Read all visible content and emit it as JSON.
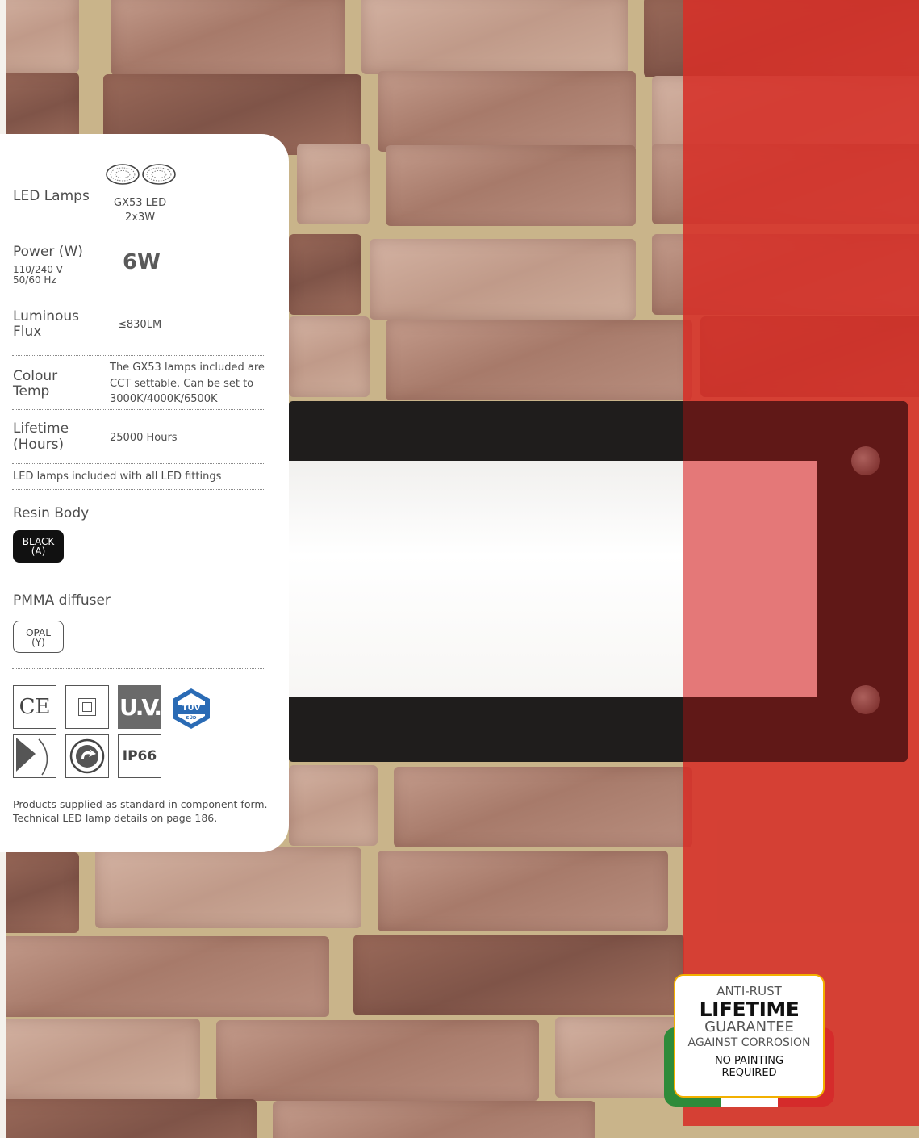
{
  "specs": {
    "led_lamps_label": "LED Lamps",
    "led_lamps_value_1": "GX53 LED",
    "led_lamps_value_2": "2x3W",
    "power_label": "Power (W)",
    "power_voltage": "110/240 V",
    "power_frequency": "50/60 Hz",
    "power_value": "6W",
    "flux_label_1": "Luminous",
    "flux_label_2": "Flux",
    "flux_value": "≤830LM",
    "colour_label_1": "Colour",
    "colour_label_2": "Temp",
    "colour_value_1": "The GX53 lamps included are",
    "colour_value_2": "CCT settable.  Can be set to",
    "colour_value_3": "3000K/4000K/6500K",
    "lifetime_label_1": "Lifetime",
    "lifetime_label_2": "(Hours)",
    "lifetime_value": "25000 Hours",
    "included_note": "LED lamps included with all LED fittings"
  },
  "body": {
    "heading": "Resin Body",
    "finish_1": "BLACK",
    "finish_2": "(A)"
  },
  "diffuser": {
    "heading": "PMMA diffuser",
    "finish_1": "OPAL",
    "finish_2": "(Y)"
  },
  "certifications": {
    "ce": "CE",
    "uv": "U.V.",
    "tuv_1": "TÜV",
    "tuv_2": "SÜD",
    "ip": "IP66",
    "icons": [
      "ce-icon",
      "class-ii-icon",
      "uv-icon",
      "tuv-icon",
      "flammable-surface-icon",
      "rotatable-icon",
      "ip66-icon"
    ]
  },
  "notes": {
    "line_1": "Products supplied as standard in component form.",
    "line_2": "Technical LED lamp details on page 186."
  },
  "badge": {
    "line_1": "ANTI-RUST",
    "line_2": "LIFETIME",
    "line_3": "GUARANTEE",
    "line_4": "AGAINST CORROSION",
    "line_5": "NO PAINTING",
    "line_6": "REQUIRED"
  },
  "colors": {
    "accent_red": "#d63028",
    "badge_border": "#f2b000",
    "flag_green": "#2e8b3a",
    "flag_red": "#d52b2b"
  }
}
